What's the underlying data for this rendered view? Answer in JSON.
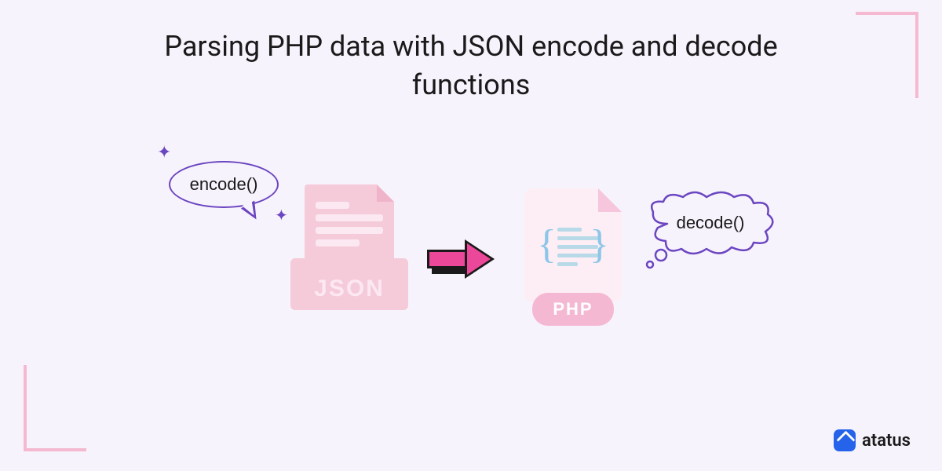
{
  "title": "Parsing PHP data with JSON encode and decode functions",
  "encode_label": "encode()",
  "decode_label": "decode()",
  "json_badge": "JSON",
  "php_badge": "PHP",
  "brand": "atatus",
  "colors": {
    "background": "#f7f3fc",
    "pink_accent": "#f4b9d0",
    "purple": "#6b46c1",
    "arrow_pink": "#ec4899",
    "brand_blue": "#2563eb"
  }
}
